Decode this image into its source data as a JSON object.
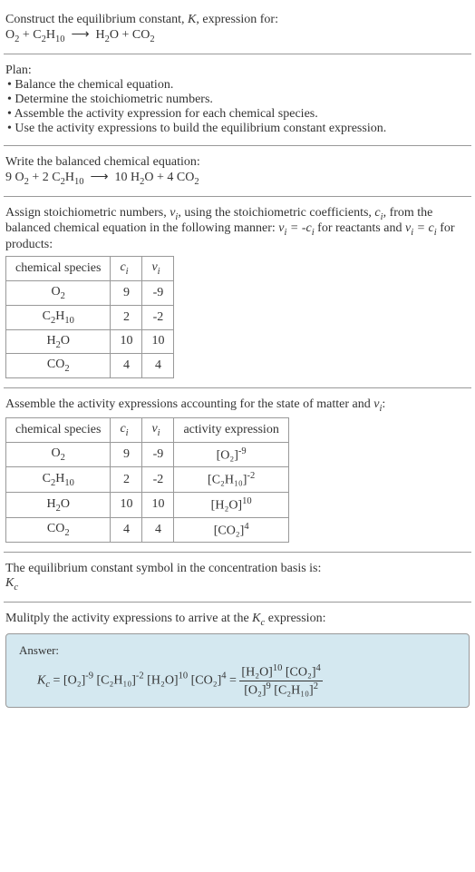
{
  "header": {
    "line1": "Construct the equilibrium constant, ",
    "k": "K",
    "line1b": ", expression for:",
    "equation_text": "O₂ + C₂H₁₀ ⟶ H₂O + CO₂"
  },
  "plan": {
    "title": "Plan:",
    "items": [
      "• Balance the chemical equation.",
      "• Determine the stoichiometric numbers.",
      "• Assemble the activity expression for each chemical species.",
      "• Use the activity expressions to build the equilibrium constant expression."
    ]
  },
  "balanced": {
    "title": "Write the balanced chemical equation:",
    "equation": "9 O₂ + 2 C₂H₁₀ ⟶ 10 H₂O + 4 CO₂"
  },
  "assign": {
    "text1": "Assign stoichiometric numbers, ",
    "nu": "ν",
    "sub_i": "i",
    "text2": ", using the stoichiometric coefficients, ",
    "c": "c",
    "text3": ", from the balanced chemical equation in the following manner: ",
    "rel1": "νᵢ = -cᵢ",
    "text4": " for reactants and ",
    "rel2": "νᵢ = cᵢ",
    "text5": " for products:",
    "table": {
      "headers": [
        "chemical species",
        "cᵢ",
        "νᵢ"
      ],
      "rows": [
        [
          "O₂",
          "9",
          "-9"
        ],
        [
          "C₂H₁₀",
          "2",
          "-2"
        ],
        [
          "H₂O",
          "10",
          "10"
        ],
        [
          "CO₂",
          "4",
          "4"
        ]
      ]
    }
  },
  "activity": {
    "text1": "Assemble the activity expressions accounting for the state of matter and ",
    "nu": "νᵢ",
    "text2": ":",
    "table": {
      "headers": [
        "chemical species",
        "cᵢ",
        "νᵢ",
        "activity expression"
      ],
      "rows": [
        {
          "species": "O₂",
          "c": "9",
          "nu": "-9",
          "expr_base": "[O₂]",
          "expr_sup": "-9"
        },
        {
          "species": "C₂H₁₀",
          "c": "2",
          "nu": "-2",
          "expr_base": "[C₂H₁₀]",
          "expr_sup": "-2"
        },
        {
          "species": "H₂O",
          "c": "10",
          "nu": "10",
          "expr_base": "[H₂O]",
          "expr_sup": "10"
        },
        {
          "species": "CO₂",
          "c": "4",
          "nu": "4",
          "expr_base": "[CO₂]",
          "expr_sup": "4"
        }
      ]
    }
  },
  "symbol": {
    "text": "The equilibrium constant symbol in the concentration basis is:",
    "kc": "K",
    "kc_sub": "c"
  },
  "multiply": {
    "text1": "Mulitply the activity expressions to arrive at the ",
    "kc": "K",
    "kc_sub": "c",
    "text2": " expression:"
  },
  "answer": {
    "label": "Answer:",
    "lhs_k": "K",
    "lhs_sub": "c",
    "eq": " = ",
    "t1_base": "[O₂]",
    "t1_sup": "-9",
    "t2_base": "[C₂H₁₀]",
    "t2_sup": "-2",
    "t3_base": "[H₂O]",
    "t3_sup": "10",
    "t4_base": "[CO₂]",
    "t4_sup": "4",
    "num1_base": "[H₂O]",
    "num1_sup": "10",
    "num2_base": "[CO₂]",
    "num2_sup": "4",
    "den1_base": "[O₂]",
    "den1_sup": "9",
    "den2_base": "[C₂H₁₀]",
    "den2_sup": "2"
  }
}
